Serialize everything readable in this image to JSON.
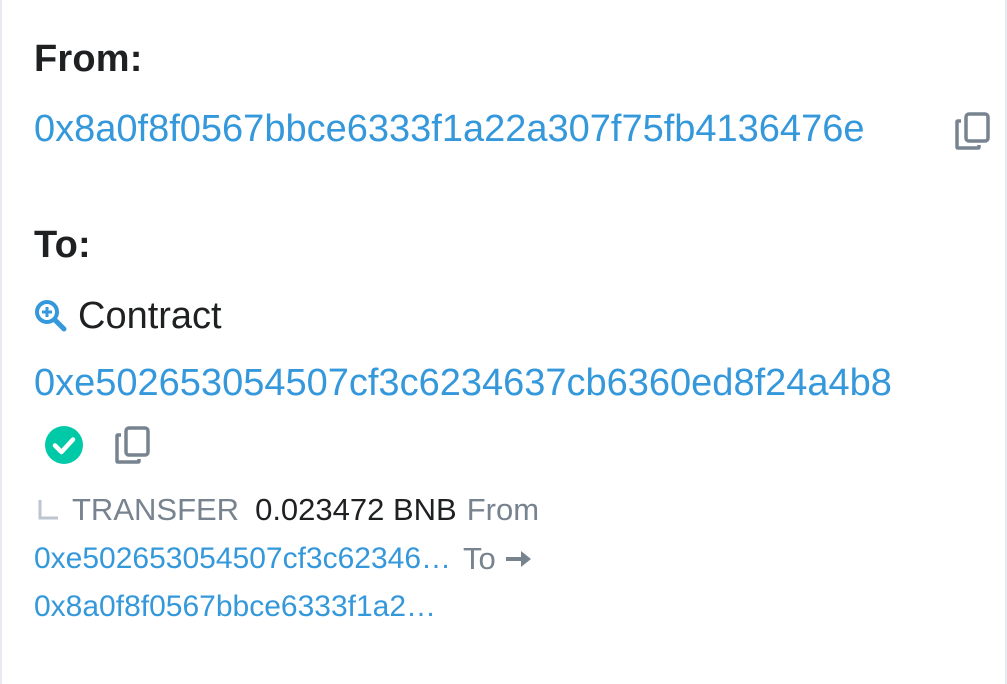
{
  "from": {
    "label": "From:",
    "address": "0x8a0f8f0567bbce6333f1a22a307f75fb4136476e"
  },
  "to": {
    "label": "To:",
    "contract_label": "Contract",
    "address": "0xe502653054507cf3c6234637cb6360ed8f24a4b8"
  },
  "transfer": {
    "type_label": "TRANSFER",
    "amount": "0.023472 BNB",
    "from_label": "From",
    "from_address": "0xe502653054507cf3c62346…",
    "to_label": "To",
    "to_address": "0x8a0f8f0567bbce6333f1a2…"
  },
  "icons": {
    "copy": "copy-icon",
    "zoom": "search-plus-icon",
    "verified": "check-circle-icon",
    "branch": "corner-down-right-icon",
    "arrow": "arrow-right-icon"
  },
  "colors": {
    "link": "#3498db",
    "verified": "#00c9a7",
    "muted": "#77838f",
    "text": "#1e2022"
  }
}
